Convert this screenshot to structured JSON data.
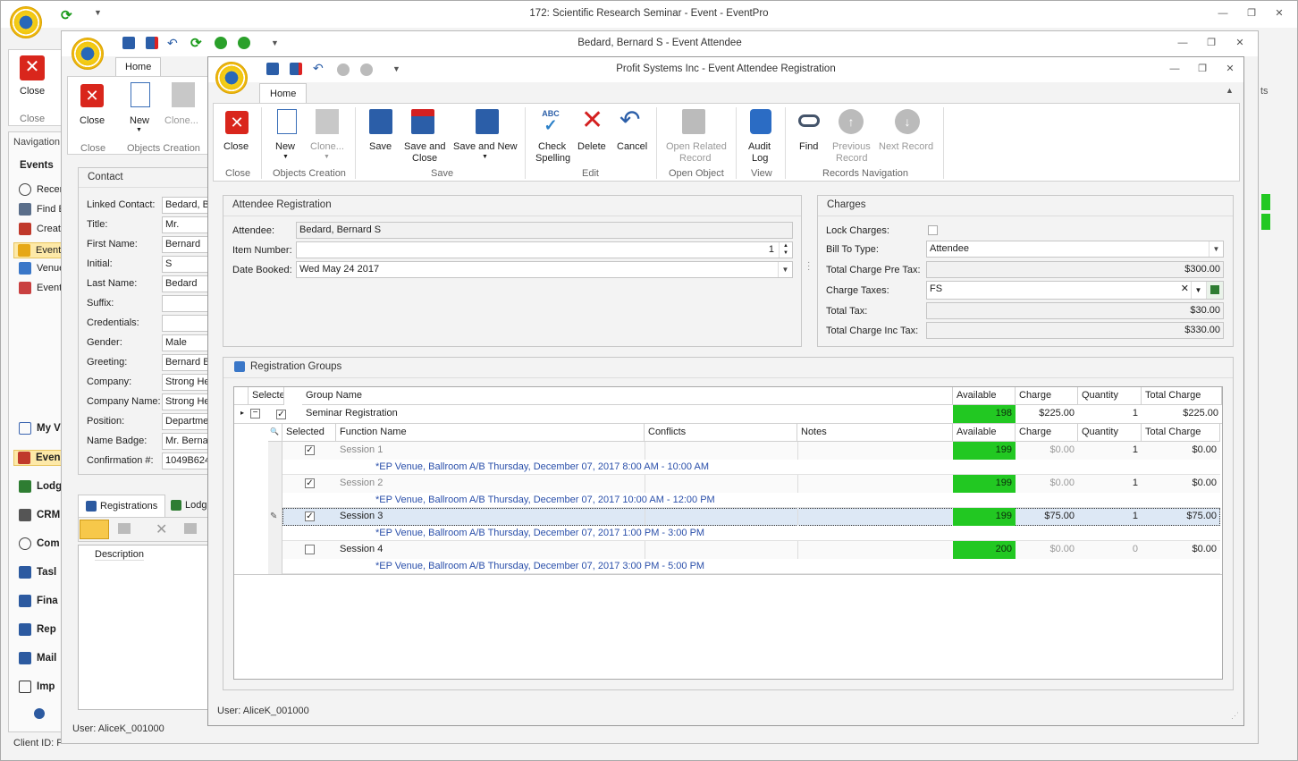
{
  "main_window": {
    "title": "172: Scientific Research Seminar - Event - EventPro",
    "close_label": "Close",
    "close_group": "Close",
    "nav_header": "Navigation",
    "events_header": "Events",
    "nav_items": [
      "Recen",
      "Find E",
      "Creat",
      "Event",
      "Venue",
      "Event"
    ],
    "bottom_items": [
      "My V",
      "Even",
      "Lodg",
      "CRM",
      "Com",
      "Tasl",
      "Fina",
      "Rep",
      "Mail",
      "Imp"
    ],
    "status": "Client ID: P",
    "right_ts": "ts"
  },
  "attendee_window": {
    "title": "Bedard, Bernard S - Event Attendee",
    "home_tab": "Home",
    "buttons": {
      "close": "Close",
      "new": "New",
      "clone": "Clone..."
    },
    "groups": {
      "close": "Close",
      "objects": "Objects Creation"
    },
    "contact_header": "Contact",
    "contact_fields": [
      {
        "label": "Linked Contact:",
        "value": "Bedard, B"
      },
      {
        "label": "Title:",
        "value": "Mr."
      },
      {
        "label": "First Name:",
        "value": "Bernard"
      },
      {
        "label": "Initial:",
        "value": "S"
      },
      {
        "label": "Last Name:",
        "value": "Bedard"
      },
      {
        "label": "Suffix:",
        "value": ""
      },
      {
        "label": "Credentials:",
        "value": ""
      },
      {
        "label": "Gender:",
        "value": "Male"
      },
      {
        "label": "Greeting:",
        "value": "Bernard B"
      },
      {
        "label": "Company:",
        "value": "Strong He"
      },
      {
        "label": "Company Name:",
        "value": "Strong He"
      },
      {
        "label": "Position:",
        "value": "Departme"
      },
      {
        "label": "Name Badge:",
        "value": "Mr. Berna"
      },
      {
        "label": "Confirmation #:",
        "value": "1049B624"
      }
    ],
    "tabs": {
      "registrations": "Registrations",
      "lodging": "Lodg"
    },
    "desc_header": "Description",
    "status": "User: AliceK_001000"
  },
  "registration_window": {
    "title": "Profit Systems Inc - Event Attendee Registration",
    "home_tab": "Home",
    "buttons": {
      "close": "Close",
      "new": "New",
      "clone": "Clone...",
      "save": "Save",
      "save_close_1": "Save and",
      "save_close_2": "Close",
      "save_new": "Save and New",
      "check_1": "Check",
      "check_2": "Spelling",
      "delete": "Delete",
      "cancel": "Cancel",
      "open_related_1": "Open Related",
      "open_related_2": "Record",
      "audit_1": "Audit",
      "audit_2": "Log",
      "find": "Find",
      "prev_1": "Previous",
      "prev_2": "Record",
      "next_1": "Next Record",
      "abc": "ABC"
    },
    "groups": {
      "close": "Close",
      "objects": "Objects Creation",
      "save": "Save",
      "edit": "Edit",
      "open_object": "Open Object",
      "view": "View",
      "records_nav": "Records Navigation"
    },
    "attendee_reg": {
      "header": "Attendee Registration",
      "attendee_label": "Attendee:",
      "attendee_value": "Bedard, Bernard S",
      "item_label": "Item Number:",
      "item_value": "1",
      "date_label": "Date Booked:",
      "date_value": "Wed May 24 2017"
    },
    "charges": {
      "header": "Charges",
      "lock_label": "Lock Charges:",
      "bill_label": "Bill To Type:",
      "bill_value": "Attendee",
      "pretax_label": "Total Charge Pre Tax:",
      "pretax_value": "$300.00",
      "taxes_label": "Charge Taxes:",
      "taxes_value": "FS",
      "tax_label": "Total Tax:",
      "tax_value": "$30.00",
      "inctax_label": "Total Charge Inc Tax:",
      "inctax_value": "$330.00"
    },
    "groups_panel": {
      "header": "Registration Groups",
      "columns": [
        "Selected",
        "Group Name",
        "Available",
        "Charge",
        "Quantity",
        "Total Charge"
      ],
      "group_row": {
        "name": "Seminar Registration",
        "available": "198",
        "charge": "$225.00",
        "quantity": "1",
        "total": "$225.00"
      },
      "sub_columns": [
        "Selected",
        "Function Name",
        "Conflicts",
        "Notes",
        "Available",
        "Charge",
        "Quantity",
        "Total Charge"
      ],
      "sessions": [
        {
          "name": "Session 1",
          "available": "199",
          "charge": "$0.00",
          "quantity": "1",
          "total": "$0.00",
          "checked": true,
          "venue": "*EP Venue, Ballroom A/B Thursday, December 07, 2017 8:00 AM - 10:00 AM"
        },
        {
          "name": "Session 2",
          "available": "199",
          "charge": "$0.00",
          "quantity": "1",
          "total": "$0.00",
          "checked": true,
          "venue": "*EP Venue, Ballroom A/B Thursday, December 07, 2017 10:00 AM - 12:00 PM"
        },
        {
          "name": "Session 3",
          "available": "199",
          "charge": "$75.00",
          "quantity": "1",
          "total": "$75.00",
          "checked": true,
          "venue": "*EP Venue, Ballroom A/B Thursday, December 07, 2017 1:00 PM - 3:00 PM"
        },
        {
          "name": "Session 4",
          "available": "200",
          "charge": "$0.00",
          "quantity": "0",
          "total": "$0.00",
          "checked": false,
          "venue": "*EP Venue, Ballroom A/B Thursday, December 07, 2017 3:00 PM - 5:00 PM"
        }
      ]
    },
    "status": "User: AliceK_001000"
  },
  "colors": {
    "available_green": "#22c822",
    "venue_blue": "#2a4faa",
    "delete_red": "#d42020"
  }
}
